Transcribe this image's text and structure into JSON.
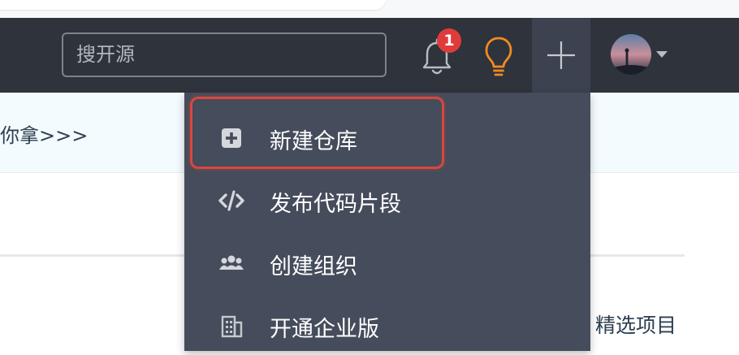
{
  "search": {
    "placeholder": "搜开源"
  },
  "notifications": {
    "count": "1"
  },
  "banner": {
    "text": "你拿>>>"
  },
  "featured": {
    "text": "精选项目"
  },
  "create_menu": {
    "items": [
      {
        "label": "新建仓库",
        "icon": "plus-square-icon"
      },
      {
        "label": "发布代码片段",
        "icon": "code-icon"
      },
      {
        "label": "创建组织",
        "icon": "users-icon"
      },
      {
        "label": "开通企业版",
        "icon": "building-icon"
      }
    ]
  },
  "colors": {
    "navbar": "#2f333b",
    "menu": "#454c5b",
    "badge": "#e03b3b",
    "bulb": "#f18b21",
    "highlight": "#d8473d"
  }
}
